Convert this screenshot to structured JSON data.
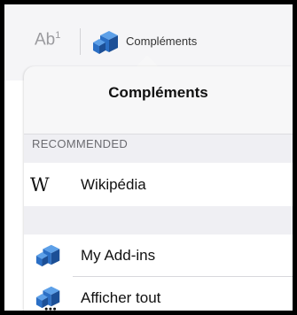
{
  "toolbar": {
    "ab_label": "Ab",
    "ab_superscript": "1",
    "addins_label": "Compléments",
    "addins_icon": "addins-cube-icon"
  },
  "popover": {
    "title": "Compléments",
    "section_header": "RECOMMENDED",
    "recommended": [
      {
        "label": "Wikipédia",
        "icon": "wikipedia-w-icon",
        "glyph": "W"
      }
    ],
    "items": [
      {
        "label": "My Add-ins",
        "icon": "addins-cube-icon"
      },
      {
        "label": "Afficher tout",
        "icon": "addins-more-icon"
      }
    ]
  },
  "colors": {
    "cube_primary": "#2b6fc5",
    "cube_light": "#5da0e8",
    "cube_dark": "#1c4f96"
  }
}
